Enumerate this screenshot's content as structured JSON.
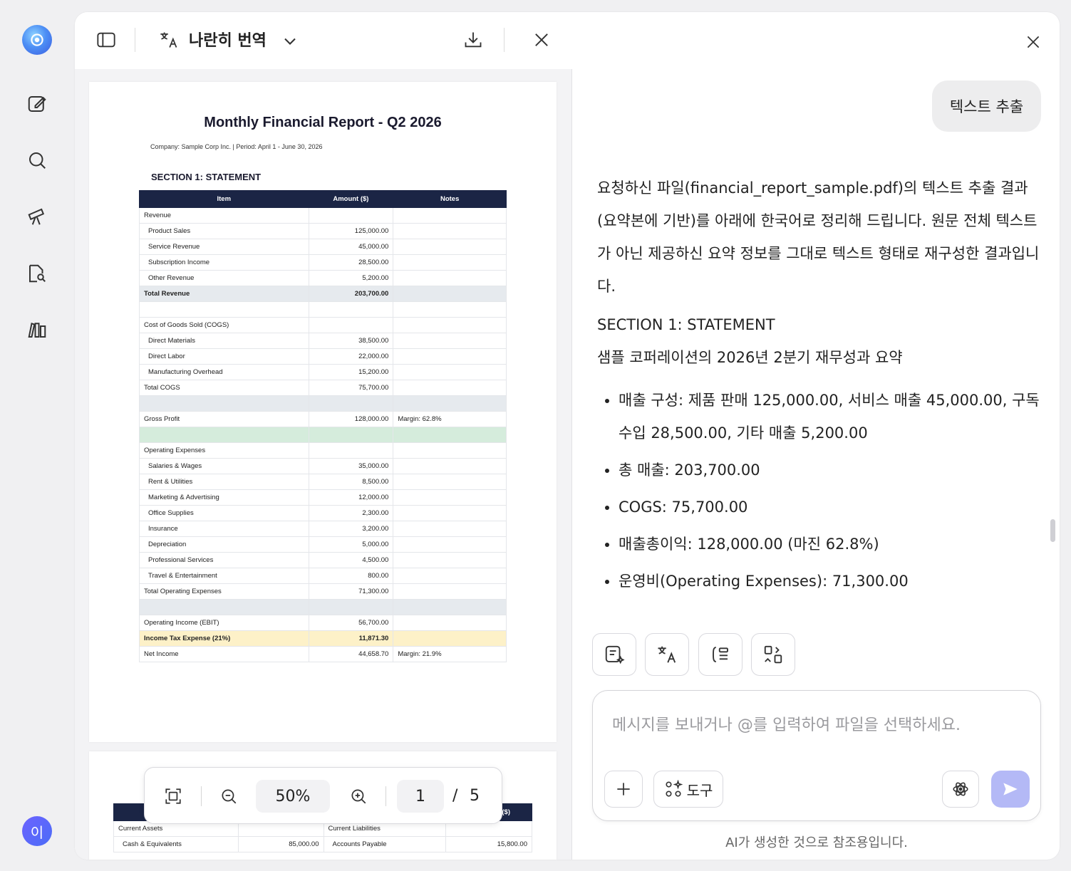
{
  "toolbar": {
    "mode_label": "나란히 번역"
  },
  "report": {
    "title": "Monthly Financial Report - Q2 2026",
    "subtitle": "Company: Sample Corp Inc. | Period: April 1 - June 30, 2026",
    "section": "SECTION 1: STATEMENT",
    "headers": [
      "Item",
      "Amount ($)",
      "Notes"
    ],
    "rows": [
      {
        "item": "Revenue",
        "amount": "",
        "notes": "",
        "style": ""
      },
      {
        "item": "Product Sales",
        "amount": "125,000.00",
        "notes": "",
        "style": "ind"
      },
      {
        "item": "Service Revenue",
        "amount": "45,000.00",
        "notes": "",
        "style": "ind"
      },
      {
        "item": "Subscription Income",
        "amount": "28,500.00",
        "notes": "",
        "style": "ind"
      },
      {
        "item": "Other Revenue",
        "amount": "5,200.00",
        "notes": "",
        "style": "ind"
      },
      {
        "item": "Total Revenue",
        "amount": "203,700.00",
        "notes": "",
        "style": "bold"
      },
      {
        "item": "",
        "amount": "",
        "notes": "",
        "style": ""
      },
      {
        "item": "Cost of Goods Sold (COGS)",
        "amount": "",
        "notes": "",
        "style": ""
      },
      {
        "item": "Direct Materials",
        "amount": "38,500.00",
        "notes": "",
        "style": "ind"
      },
      {
        "item": "Direct Labor",
        "amount": "22,000.00",
        "notes": "",
        "style": "ind"
      },
      {
        "item": "Manufacturing Overhead",
        "amount": "15,200.00",
        "notes": "",
        "style": "ind"
      },
      {
        "item": "Total COGS",
        "amount": "75,700.00",
        "notes": "",
        "style": ""
      },
      {
        "item": "",
        "amount": "",
        "notes": "",
        "style": "gray"
      },
      {
        "item": "Gross Profit",
        "amount": "128,000.00",
        "notes": "Margin: 62.8%",
        "style": ""
      },
      {
        "item": "",
        "amount": "",
        "notes": "",
        "style": "green"
      },
      {
        "item": "Operating Expenses",
        "amount": "",
        "notes": "",
        "style": ""
      },
      {
        "item": "Salaries & Wages",
        "amount": "35,000.00",
        "notes": "",
        "style": "ind"
      },
      {
        "item": "Rent & Utilities",
        "amount": "8,500.00",
        "notes": "",
        "style": "ind"
      },
      {
        "item": "Marketing & Advertising",
        "amount": "12,000.00",
        "notes": "",
        "style": "ind"
      },
      {
        "item": "Office Supplies",
        "amount": "2,300.00",
        "notes": "",
        "style": "ind"
      },
      {
        "item": "Insurance",
        "amount": "3,200.00",
        "notes": "",
        "style": "ind"
      },
      {
        "item": "Depreciation",
        "amount": "5,000.00",
        "notes": "",
        "style": "ind"
      },
      {
        "item": "Professional Services",
        "amount": "4,500.00",
        "notes": "",
        "style": "ind"
      },
      {
        "item": "Travel & Entertainment",
        "amount": "800.00",
        "notes": "",
        "style": "ind"
      },
      {
        "item": "Total Operating Expenses",
        "amount": "71,300.00",
        "notes": "",
        "style": ""
      },
      {
        "item": "",
        "amount": "",
        "notes": "",
        "style": "gray"
      },
      {
        "item": "Operating Income (EBIT)",
        "amount": "56,700.00",
        "notes": "",
        "style": ""
      },
      {
        "item": "Income Tax Expense (21%)",
        "amount": "11,871.30",
        "notes": "",
        "style": "yellow"
      },
      {
        "item": "Net Income",
        "amount": "44,658.70",
        "notes": "Margin: 21.9%",
        "style": ""
      }
    ]
  },
  "page2": {
    "header_right": "($)",
    "rows": [
      [
        "Current Assets",
        "",
        "Current Liabilities",
        ""
      ],
      [
        "Cash & Equivalents",
        "85,000.00",
        "Accounts Payable",
        "15,800.00"
      ]
    ]
  },
  "zoom": {
    "level": "50%",
    "page": "1",
    "separator": "/",
    "total": "5"
  },
  "chat": {
    "user_message": "텍스트 추출",
    "intro": "요청하신 파일(financial_report_sample.pdf)의 텍스트 추출 결과(요약본에 기반)를 아래에 한국어로 정리해 드립니다. 원문 전체 텍스트가 아닌 제공하신 요약 정보를 그대로 텍스트 형태로 재구성한 결과입니다.",
    "section": "SECTION 1: STATEMENT",
    "section_sub": "샘플 코퍼레이션의 2026년 2분기 재무성과 요약",
    "bullets": [
      "매출 구성: 제품 판매 125,000.00, 서비스 매출 45,000.00, 구독 수입 28,500.00, 기타 매출 5,200.00",
      "총 매출: 203,700.00",
      "COGS: 75,700.00",
      "매출총이익: 128,000.00 (마진 62.8%)",
      "운영비(Operating Expenses): 71,300.00"
    ],
    "input_placeholder": "메시지를 보내거나 @를 입력하여 파일을 선택하세요.",
    "tools_label": "도구",
    "disclaimer": "AI가 생성한 것으로 참조용입니다."
  },
  "user": {
    "avatar_initial": "이"
  },
  "colors": {
    "accent": "#4b6cf7",
    "send": "#b4b9f6",
    "table_header": "#1b2545"
  }
}
